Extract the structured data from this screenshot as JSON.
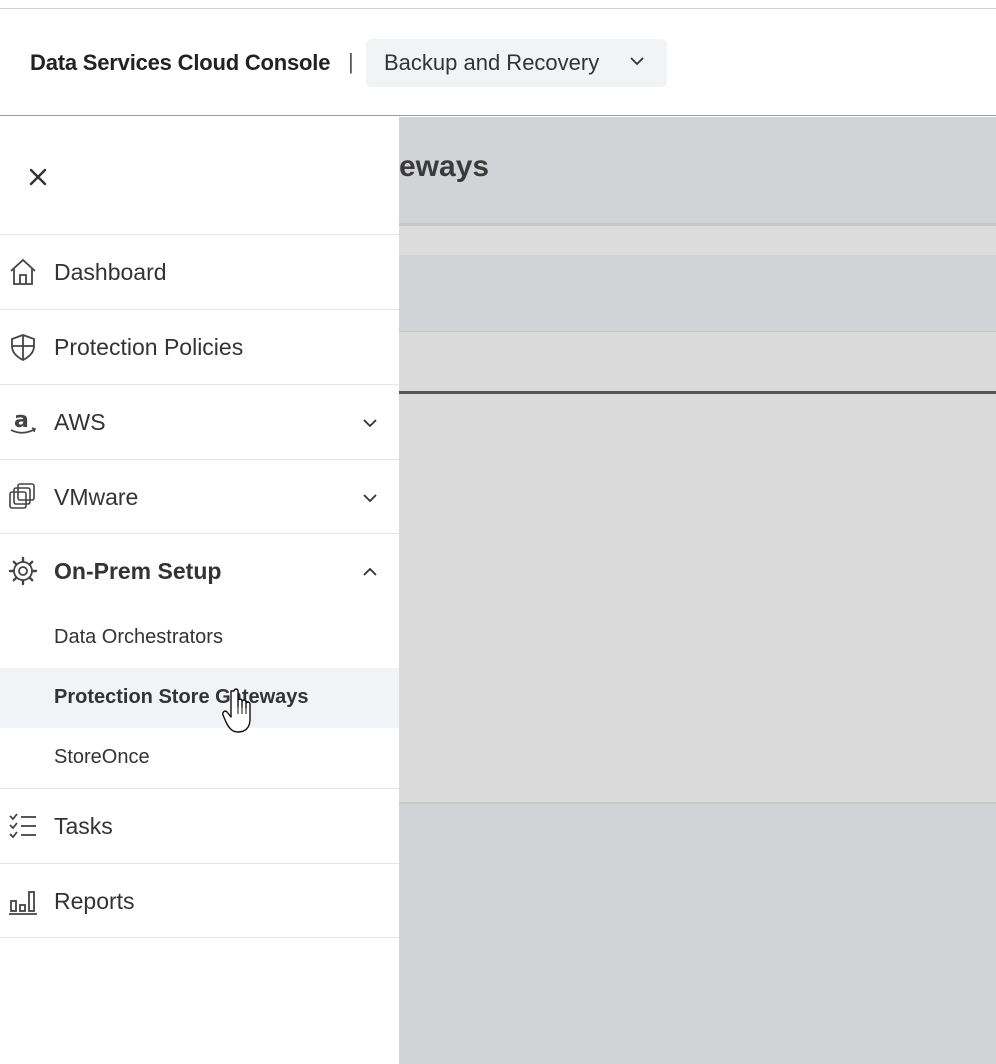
{
  "header": {
    "brand": "Data Services Cloud Console",
    "separator": "|",
    "app_selector": {
      "value": "Backup and Recovery",
      "icon": "chevron-down-icon"
    }
  },
  "background_page": {
    "title_fragment": "eways"
  },
  "sidebar": {
    "close_icon": "close-icon",
    "items": [
      {
        "label": "Dashboard",
        "icon": "home-icon",
        "expandable": false
      },
      {
        "label": "Protection Policies",
        "icon": "shield-icon",
        "expandable": false
      },
      {
        "label": "AWS",
        "icon": "amazon-icon",
        "expandable": true,
        "expanded": false
      },
      {
        "label": "VMware",
        "icon": "vmware-icon",
        "expandable": true,
        "expanded": false
      },
      {
        "label": "On-Prem Setup",
        "icon": "gear-icon",
        "expandable": true,
        "expanded": true,
        "children": [
          {
            "label": "Data Orchestrators",
            "active": false
          },
          {
            "label": "Protection Store Gateways",
            "active": true
          },
          {
            "label": "StoreOnce",
            "active": false
          }
        ]
      },
      {
        "label": "Tasks",
        "icon": "tasks-icon",
        "expandable": false
      },
      {
        "label": "Reports",
        "icon": "reports-icon",
        "expandable": false
      }
    ]
  },
  "colors": {
    "overlay": "#d2d3d6",
    "active_row": "#f2f3f6",
    "text": "#333333"
  }
}
